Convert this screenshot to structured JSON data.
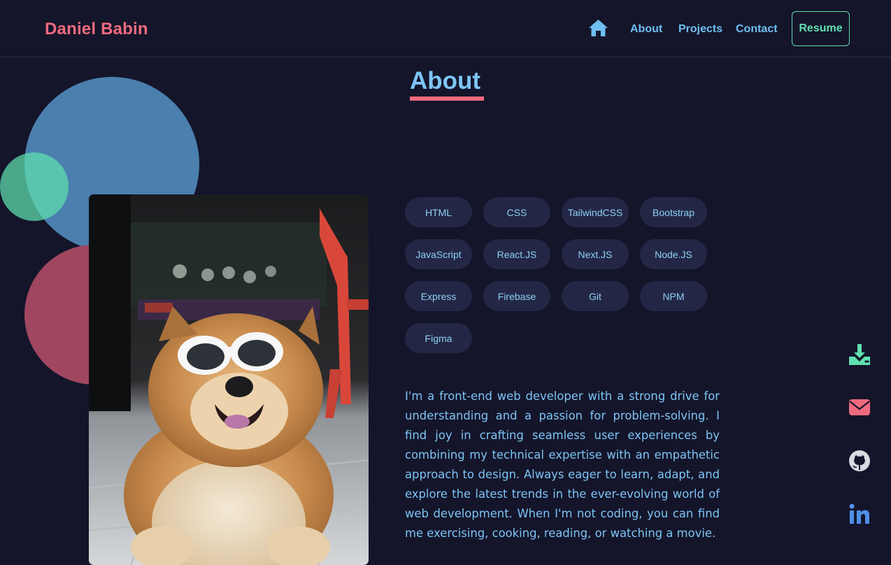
{
  "header": {
    "brand": "Daniel Babin",
    "links": [
      "About",
      "Projects",
      "Contact"
    ],
    "resume_label": "Resume",
    "home_icon": "home-icon"
  },
  "about": {
    "title": "About",
    "skills": [
      "HTML",
      "CSS",
      "TailwindCSS",
      "Bootstrap",
      "JavaScript",
      "React.JS",
      "Next.JS",
      "Node.JS",
      "Express",
      "Firebase",
      "Git",
      "NPM",
      "Figma"
    ],
    "bio": "I'm a front-end web developer with a strong drive for understanding and a passion for problem-solving. I find joy in crafting seamless user experiences by combining my technical expertise with an empathetic approach to design. Always eager to learn, adapt, and explore the latest trends in the ever-evolving world of web development. When I'm not coding, you can find me exercising, cooking, reading, or watching a movie."
  },
  "social_icons": [
    "download-icon",
    "mail-icon",
    "github-icon",
    "linkedin-icon"
  ],
  "colors": {
    "background": "#14152a",
    "accent_pink": "#f06a7e",
    "accent_blue": "#7dc4f5",
    "accent_green": "#5fe0b0",
    "chip_bg": "#232745"
  }
}
